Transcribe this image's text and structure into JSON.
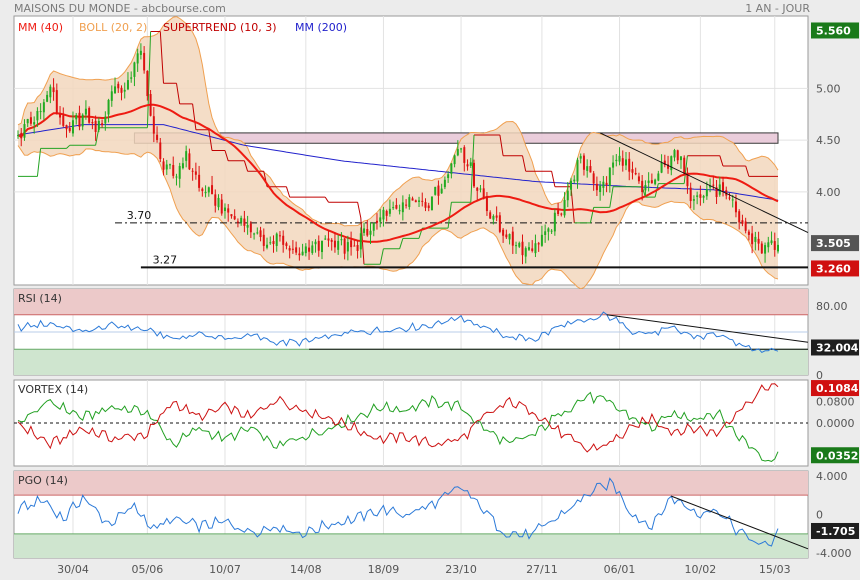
{
  "header": {
    "title": "MAISONS DU MONDE - abcbourse.com",
    "period": "1 AN - JOUR"
  },
  "colors": {
    "mm40": "#ee1b12",
    "boll": "#f0a050",
    "boll_fill": "#f2d7bd",
    "supertrend": "#c00000",
    "supertrend_up": "#23a323",
    "mm200": "#2222cc",
    "candle_up": "#22aa22",
    "candle_down": "#dd1111",
    "rsi": "#2c7ad8",
    "vortex_plus": "#22a022",
    "vortex_minus": "#cc1111",
    "pgo": "#2c7ad8",
    "over_zone": "#ecc9c9",
    "under_zone": "#cfe5cf",
    "badge_price": "#1e1e1e",
    "badge_last": "#555555",
    "badge_support": "#d01010",
    "badge_green": "#1a7a1a"
  },
  "chart_data": [
    {
      "type": "candlestick",
      "panel": "price",
      "x_tick_labels": [
        "30/04",
        "05/06",
        "10/07",
        "14/08",
        "18/09",
        "23/10",
        "27/11",
        "06/01",
        "10/02",
        "15/03"
      ],
      "x_tick_index": [
        17,
        40,
        64,
        89,
        113,
        137,
        162,
        186,
        211,
        234
      ],
      "n_sessions": 236,
      "ylim": [
        3.1,
        5.7
      ],
      "y_ticks": [
        5.0,
        4.5,
        4.0
      ],
      "legend": [
        {
          "label": "MM (40)",
          "color": "#ee1b12"
        },
        {
          "label": "BOLL (20, 2)",
          "color": "#f0a050"
        },
        {
          "label": "SUPERTREND (10, 3)",
          "color": "#c00000"
        },
        {
          "label": "MM (200)",
          "color": "#2222cc"
        }
      ],
      "close_key": [
        [
          0,
          4.55
        ],
        [
          5,
          4.7
        ],
        [
          10,
          5.0
        ],
        [
          15,
          4.55
        ],
        [
          20,
          4.75
        ],
        [
          25,
          4.6
        ],
        [
          30,
          5.05
        ],
        [
          33,
          4.95
        ],
        [
          36,
          5.25
        ],
        [
          38,
          5.35
        ],
        [
          40,
          4.95
        ],
        [
          42,
          4.55
        ],
        [
          45,
          4.25
        ],
        [
          48,
          4.15
        ],
        [
          52,
          4.35
        ],
        [
          56,
          4.05
        ],
        [
          60,
          3.95
        ],
        [
          63,
          3.85
        ],
        [
          66,
          3.75
        ],
        [
          70,
          3.72
        ],
        [
          73,
          3.6
        ],
        [
          76,
          3.5
        ],
        [
          80,
          3.55
        ],
        [
          84,
          3.45
        ],
        [
          88,
          3.42
        ],
        [
          92,
          3.45
        ],
        [
          96,
          3.55
        ],
        [
          100,
          3.5
        ],
        [
          103,
          3.42
        ],
        [
          106,
          3.55
        ],
        [
          110,
          3.65
        ],
        [
          114,
          3.8
        ],
        [
          118,
          3.85
        ],
        [
          122,
          3.9
        ],
        [
          126,
          3.9
        ],
        [
          130,
          4.0
        ],
        [
          134,
          4.3
        ],
        [
          137,
          4.45
        ],
        [
          140,
          4.2
        ],
        [
          143,
          4.0
        ],
        [
          146,
          3.8
        ],
        [
          150,
          3.6
        ],
        [
          154,
          3.5
        ],
        [
          158,
          3.45
        ],
        [
          162,
          3.55
        ],
        [
          165,
          3.65
        ],
        [
          168,
          3.85
        ],
        [
          171,
          4.1
        ],
        [
          174,
          4.3
        ],
        [
          177,
          4.2
        ],
        [
          180,
          4.0
        ],
        [
          183,
          4.2
        ],
        [
          186,
          4.35
        ],
        [
          190,
          4.15
        ],
        [
          193,
          4.0
        ],
        [
          196,
          4.1
        ],
        [
          199,
          4.2
        ],
        [
          202,
          4.35
        ],
        [
          205,
          4.3
        ],
        [
          208,
          4.0
        ],
        [
          211,
          3.95
        ],
        [
          214,
          4.05
        ],
        [
          217,
          4.0
        ],
        [
          220,
          3.9
        ],
        [
          223,
          3.75
        ],
        [
          225,
          3.6
        ],
        [
          227,
          3.55
        ],
        [
          229,
          3.5
        ],
        [
          231,
          3.45
        ],
        [
          233,
          3.5
        ],
        [
          235,
          3.505
        ]
      ],
      "ma200_key": [
        [
          0,
          4.55
        ],
        [
          20,
          4.65
        ],
        [
          45,
          4.65
        ],
        [
          70,
          4.45
        ],
        [
          100,
          4.3
        ],
        [
          130,
          4.2
        ],
        [
          160,
          4.1
        ],
        [
          190,
          4.05
        ],
        [
          215,
          4.02
        ],
        [
          235,
          3.92
        ]
      ],
      "supertrend_key": [
        [
          0,
          4.15
        ],
        [
          6,
          4.15
        ],
        [
          7,
          4.42
        ],
        [
          15,
          4.42
        ],
        [
          16,
          4.45
        ],
        [
          24,
          4.45
        ],
        [
          25,
          4.62
        ],
        [
          40,
          4.62
        ],
        [
          41,
          5.55
        ],
        [
          44,
          5.55
        ],
        [
          45,
          5.05
        ],
        [
          49,
          5.05
        ],
        [
          50,
          4.85
        ],
        [
          54,
          4.85
        ],
        [
          55,
          4.6
        ],
        [
          59,
          4.6
        ],
        [
          60,
          4.4
        ],
        [
          64,
          4.4
        ],
        [
          65,
          4.3
        ],
        [
          70,
          4.3
        ],
        [
          71,
          4.2
        ],
        [
          76,
          4.2
        ],
        [
          77,
          4.05
        ],
        [
          83,
          4.05
        ],
        [
          84,
          3.95
        ],
        [
          95,
          3.95
        ],
        [
          96,
          3.9
        ],
        [
          105,
          3.9
        ],
        [
          106,
          3.75
        ],
        [
          107,
          3.3
        ],
        [
          112,
          3.3
        ],
        [
          113,
          3.45
        ],
        [
          118,
          3.45
        ],
        [
          119,
          3.55
        ],
        [
          124,
          3.55
        ],
        [
          125,
          3.65
        ],
        [
          133,
          3.65
        ],
        [
          134,
          3.9
        ],
        [
          140,
          3.9
        ],
        [
          141,
          4.55
        ],
        [
          149,
          4.55
        ],
        [
          150,
          4.35
        ],
        [
          156,
          4.35
        ],
        [
          157,
          4.2
        ],
        [
          165,
          4.2
        ],
        [
          166,
          4.05
        ],
        [
          171,
          4.05
        ],
        [
          172,
          3.7
        ],
        [
          177,
          3.7
        ],
        [
          178,
          3.85
        ],
        [
          183,
          3.85
        ],
        [
          184,
          4.05
        ],
        [
          193,
          4.05
        ],
        [
          194,
          3.95
        ],
        [
          197,
          3.95
        ],
        [
          198,
          4.08
        ],
        [
          206,
          4.08
        ],
        [
          207,
          4.35
        ],
        [
          217,
          4.35
        ],
        [
          218,
          4.25
        ],
        [
          225,
          4.25
        ],
        [
          226,
          4.15
        ],
        [
          235,
          4.15
        ]
      ],
      "supertrend_green_ranges": [
        [
          0,
          40
        ],
        [
          107,
          140
        ],
        [
          172,
          206
        ]
      ],
      "resistance_zone": [
        4.47,
        4.57
      ],
      "levels": [
        {
          "label": "3.70",
          "value": 3.7,
          "from": 30
        },
        {
          "label": "3.27",
          "value": 3.27,
          "from": 38
        }
      ],
      "trendline": {
        "from": [
          180,
          4.57
        ],
        "to": [
          240,
          3.72
        ]
      },
      "last_price": {
        "label": "3.505",
        "value": 3.505
      },
      "top_label": {
        "label": "5.560",
        "value": 5.56
      },
      "support_label": {
        "label": "3.260",
        "value": 3.26
      }
    },
    {
      "type": "line",
      "panel": "rsi",
      "name": "RSI (14)",
      "ylim": [
        0,
        100
      ],
      "y_ticks": [
        80,
        0
      ],
      "y_tick_labels": [
        "80.00",
        "0"
      ],
      "overbought": 70,
      "oversold": 30,
      "key": [
        [
          0,
          55
        ],
        [
          10,
          60
        ],
        [
          20,
          50
        ],
        [
          30,
          58
        ],
        [
          40,
          52
        ],
        [
          48,
          42
        ],
        [
          56,
          48
        ],
        [
          64,
          42
        ],
        [
          72,
          46
        ],
        [
          80,
          38
        ],
        [
          88,
          38
        ],
        [
          96,
          44
        ],
        [
          104,
          50
        ],
        [
          112,
          52
        ],
        [
          120,
          55
        ],
        [
          128,
          58
        ],
        [
          137,
          68
        ],
        [
          144,
          55
        ],
        [
          152,
          44
        ],
        [
          160,
          42
        ],
        [
          168,
          58
        ],
        [
          176,
          62
        ],
        [
          182,
          70
        ],
        [
          190,
          52
        ],
        [
          196,
          48
        ],
        [
          202,
          54
        ],
        [
          210,
          44
        ],
        [
          216,
          48
        ],
        [
          222,
          36
        ],
        [
          228,
          31
        ],
        [
          232,
          29
        ],
        [
          235,
          32
        ]
      ],
      "trendline": {
        "from": [
          182,
          70
        ],
        "to": [
          240,
          42
        ]
      },
      "support": {
        "value": 30,
        "from": 90
      },
      "last": {
        "label": "32.004",
        "value": 32.004
      }
    },
    {
      "type": "line",
      "panel": "vortex",
      "name": "VORTEX (14)",
      "ylim": [
        -0.16,
        0.16
      ],
      "y_ticks": [
        0.08,
        0.0
      ],
      "y_tick_labels": [
        "0.0800",
        "0.0000"
      ],
      "plus_key": [
        [
          0,
          0.0
        ],
        [
          10,
          0.08
        ],
        [
          20,
          0.02
        ],
        [
          30,
          0.06
        ],
        [
          40,
          0.04
        ],
        [
          48,
          -0.08
        ],
        [
          56,
          -0.02
        ],
        [
          64,
          -0.06
        ],
        [
          72,
          -0.02
        ],
        [
          80,
          -0.09
        ],
        [
          88,
          -0.05
        ],
        [
          96,
          -0.02
        ],
        [
          104,
          0.02
        ],
        [
          112,
          0.06
        ],
        [
          120,
          0.05
        ],
        [
          128,
          0.08
        ],
        [
          137,
          0.06
        ],
        [
          144,
          -0.02
        ],
        [
          152,
          -0.08
        ],
        [
          160,
          -0.04
        ],
        [
          168,
          0.04
        ],
        [
          176,
          0.1
        ],
        [
          182,
          0.08
        ],
        [
          190,
          0.02
        ],
        [
          196,
          -0.02
        ],
        [
          202,
          0.03
        ],
        [
          210,
          0.02
        ],
        [
          216,
          0.04
        ],
        [
          222,
          -0.04
        ],
        [
          228,
          -0.1
        ],
        [
          232,
          -0.14
        ],
        [
          235,
          -0.12
        ]
      ],
      "minus_key": [
        [
          0,
          0.0
        ],
        [
          10,
          -0.08
        ],
        [
          20,
          -0.02
        ],
        [
          30,
          -0.06
        ],
        [
          40,
          -0.04
        ],
        [
          48,
          0.08
        ],
        [
          56,
          0.02
        ],
        [
          64,
          0.06
        ],
        [
          72,
          0.02
        ],
        [
          80,
          0.09
        ],
        [
          88,
          0.05
        ],
        [
          96,
          0.02
        ],
        [
          104,
          -0.02
        ],
        [
          112,
          -0.06
        ],
        [
          120,
          -0.05
        ],
        [
          128,
          -0.08
        ],
        [
          137,
          -0.06
        ],
        [
          144,
          0.02
        ],
        [
          152,
          0.08
        ],
        [
          160,
          0.04
        ],
        [
          168,
          -0.04
        ],
        [
          176,
          -0.1
        ],
        [
          182,
          -0.08
        ],
        [
          190,
          -0.02
        ],
        [
          196,
          0.02
        ],
        [
          202,
          -0.03
        ],
        [
          210,
          -0.02
        ],
        [
          216,
          -0.04
        ],
        [
          222,
          0.04
        ],
        [
          228,
          0.1
        ],
        [
          232,
          0.14
        ],
        [
          235,
          0.13
        ]
      ],
      "zero_line": 0.0,
      "last_plus": {
        "label": "0.1084",
        "value": 0.13
      },
      "last_minus": {
        "label": "0.0352",
        "value": -0.12
      }
    },
    {
      "type": "line",
      "panel": "pgo",
      "name": "PGO (14)",
      "ylim": [
        -4.5,
        4.5
      ],
      "y_ticks": [
        4.0,
        0,
        -4.0
      ],
      "y_tick_labels": [
        "4.000",
        "0",
        "-4.000"
      ],
      "overbought": 2.0,
      "oversold": -2.0,
      "key": [
        [
          0,
          0.5
        ],
        [
          8,
          1.5
        ],
        [
          14,
          -0.5
        ],
        [
          20,
          1.8
        ],
        [
          28,
          -1.0
        ],
        [
          36,
          0.8
        ],
        [
          42,
          -1.5
        ],
        [
          48,
          -0.5
        ],
        [
          56,
          -1.2
        ],
        [
          64,
          -0.8
        ],
        [
          72,
          -1.8
        ],
        [
          80,
          -1.2
        ],
        [
          88,
          -2.0
        ],
        [
          96,
          -1.0
        ],
        [
          104,
          -0.5
        ],
        [
          112,
          0.5
        ],
        [
          120,
          0.0
        ],
        [
          128,
          1.0
        ],
        [
          137,
          2.8
        ],
        [
          144,
          0.5
        ],
        [
          150,
          -1.8
        ],
        [
          158,
          -2.2
        ],
        [
          164,
          -1.0
        ],
        [
          170,
          0.5
        ],
        [
          178,
          2.5
        ],
        [
          184,
          3.2
        ],
        [
          190,
          0.0
        ],
        [
          196,
          -1.2
        ],
        [
          202,
          1.8
        ],
        [
          210,
          0.2
        ],
        [
          216,
          0.5
        ],
        [
          222,
          -1.5
        ],
        [
          226,
          -2.5
        ],
        [
          230,
          -3.2
        ],
        [
          233,
          -2.8
        ],
        [
          235,
          -1.705
        ]
      ],
      "trendline": {
        "from": [
          202,
          1.9
        ],
        "to": [
          240,
          -2.6
        ]
      },
      "last": {
        "label": "-1.705",
        "value": -1.705
      }
    }
  ]
}
